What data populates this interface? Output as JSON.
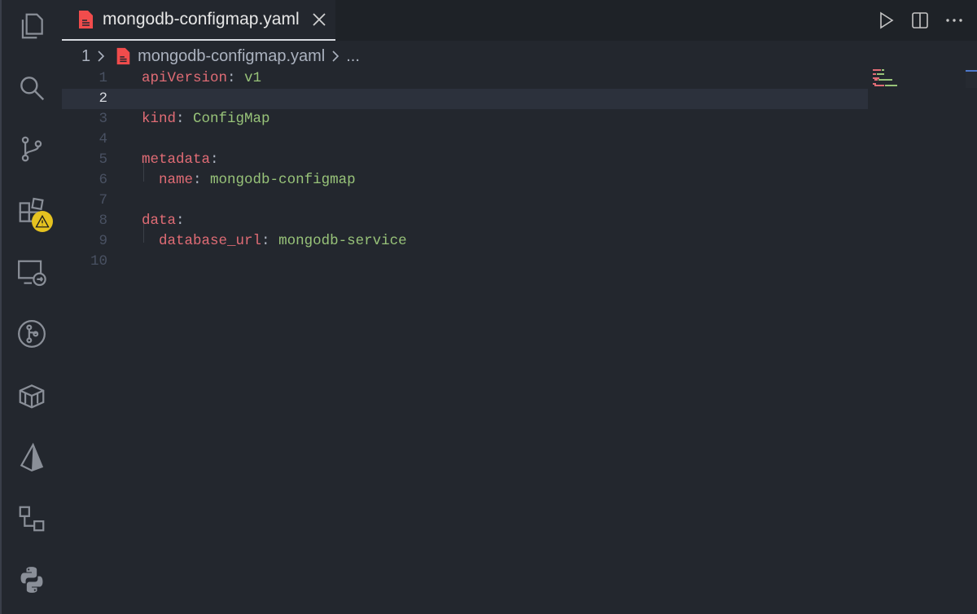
{
  "activity_bar": {
    "icons": [
      "files-icon",
      "search-icon",
      "source-control-icon",
      "extensions-icon",
      "remote-explorer-icon",
      "gitlens-icon",
      "docker-icon",
      "prisma-icon",
      "kubernetes-icon",
      "python-icon"
    ]
  },
  "tab": {
    "label": "mongodb-configmap.yaml"
  },
  "breadcrumb": {
    "root": "1",
    "file": "mongodb-configmap.yaml",
    "more": "..."
  },
  "editor": {
    "current_line": 2,
    "lines": [
      {
        "num": "1",
        "key": "apiVersion",
        "sep": ":",
        "value": " v1",
        "indent": ""
      },
      {
        "num": "2",
        "key": "",
        "sep": "",
        "value": "",
        "indent": ""
      },
      {
        "num": "3",
        "key": "kind",
        "sep": ":",
        "value": " ConfigMap",
        "indent": ""
      },
      {
        "num": "4",
        "key": "",
        "sep": "",
        "value": "",
        "indent": ""
      },
      {
        "num": "5",
        "key": "metadata",
        "sep": ":",
        "value": "",
        "indent": ""
      },
      {
        "num": "6",
        "key": "name",
        "sep": ":",
        "value": " mongodb-configmap",
        "indent": "  "
      },
      {
        "num": "7",
        "key": "",
        "sep": "",
        "value": "",
        "indent": ""
      },
      {
        "num": "8",
        "key": "data",
        "sep": ":",
        "value": "",
        "indent": ""
      },
      {
        "num": "9",
        "key": "database_url",
        "sep": ":",
        "value": " mongodb-service",
        "indent": "  "
      },
      {
        "num": "10",
        "key": "",
        "sep": "",
        "value": "",
        "indent": ""
      }
    ]
  },
  "colors": {
    "key": "#e06c75",
    "value": "#98c379",
    "background": "#23272e",
    "file_icon": "#f14c4c",
    "warning_badge": "#e5c220"
  }
}
